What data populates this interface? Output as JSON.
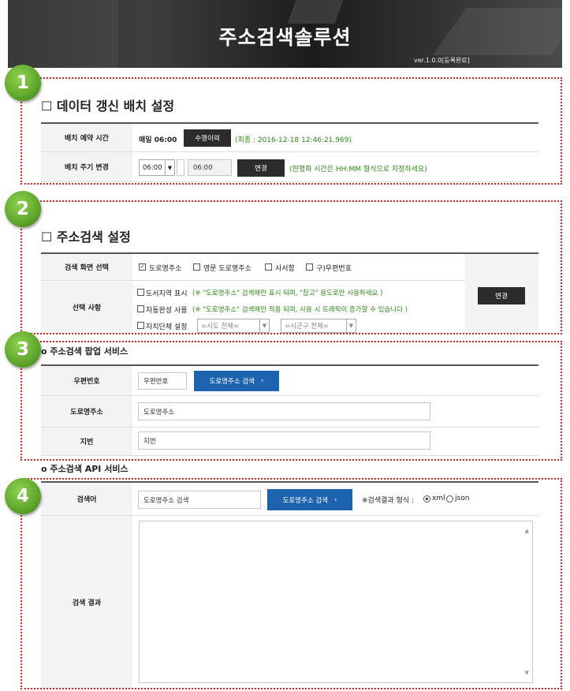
{
  "header": {
    "title": "주소검색솔루션",
    "version": "ver.1.0.0[등록완료]"
  },
  "badges": [
    "1",
    "2",
    "3",
    "4"
  ],
  "batch": {
    "title": "☐ 데이터 갱신 배치 설정",
    "reserve_label": "배치 예약 시간",
    "reserve_value": "매일 06:00",
    "history_button": "수행이력",
    "last_run": "(최종 : 2016-12-18 12:46:21.969)",
    "cycle_label": "배치 주기 변경",
    "cycle_select": "06:00",
    "cycle_input": "06:00",
    "change_button": "변경",
    "cycle_note": "(현행화 시간은 HH:MM 형식으로 지정하세요)"
  },
  "search_settings": {
    "title": "☐ 주소검색 설정",
    "screen_label": "검색 화면 선택",
    "options": [
      {
        "label": "도로명주소",
        "checked": true
      },
      {
        "label": "영문 도로명주소",
        "checked": false
      },
      {
        "label": "사서함",
        "checked": false
      },
      {
        "label": "구)우편번호",
        "checked": false
      }
    ],
    "select_label": "선택 사항",
    "extra1_label": "도서지역 표시",
    "extra1_note": "(※ \"도로명주소\" 검색에만 표시 되며, \"참고\" 용도로만 사용하세요 )",
    "extra2_label": "자동완성 사용",
    "extra2_note": "(※ \"도로명주소\" 검색에만 적용 되며, 사용 시 트래픽이 증가할 수 있습니다 )",
    "extra3_label": "자치단체 설정",
    "sido_select": "=시도 전체=",
    "sigungu_select": "=시군구 전체=",
    "change_button": "변경"
  },
  "popup_service": {
    "title": "o 주소검색 팝업 서비스",
    "zip_label": "우편번호",
    "zip_value": "우편번호",
    "search_button": "도로명주소 검색",
    "road_label": "도로명주소",
    "road_value": "도로명주소",
    "jibun_label": "지번",
    "jibun_value": "지번"
  },
  "api_service": {
    "title": "o 주소검색 API 서비스",
    "keyword_label": "검색어",
    "keyword_value": "도로명주소 검색",
    "search_button": "도로명주소 검색",
    "format_label": "※검색결과 형식 :",
    "format_xml": "xml",
    "format_json": "json",
    "result_label": "검색 결과"
  }
}
